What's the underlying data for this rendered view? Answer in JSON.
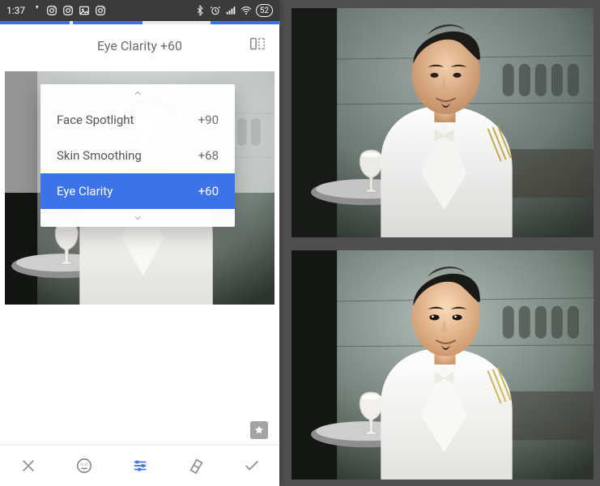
{
  "statusbar": {
    "time": "1:37",
    "battery": "52"
  },
  "header": {
    "caption": "Eye Clarity +60"
  },
  "panel": {
    "items": [
      {
        "label": "Face Spotlight",
        "value": "+90"
      },
      {
        "label": "Skin Smoothing",
        "value": "+68"
      },
      {
        "label": "Eye Clarity",
        "value": "+60"
      }
    ],
    "selected_index": 2
  },
  "accent": "#3d73e8"
}
